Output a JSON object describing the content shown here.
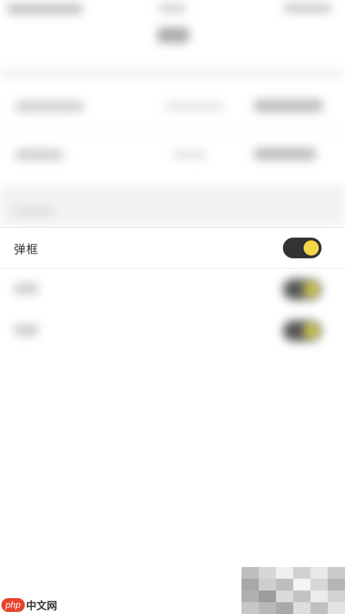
{
  "settings_row": {
    "label": "弹框",
    "toggle_on": true
  },
  "colors": {
    "toggle_track": "#333333",
    "toggle_knob": "#f5d648",
    "background": "#ffffff",
    "section_gray": "#f2f2f2"
  },
  "watermark": {
    "logo": "php",
    "text": "中文网"
  }
}
